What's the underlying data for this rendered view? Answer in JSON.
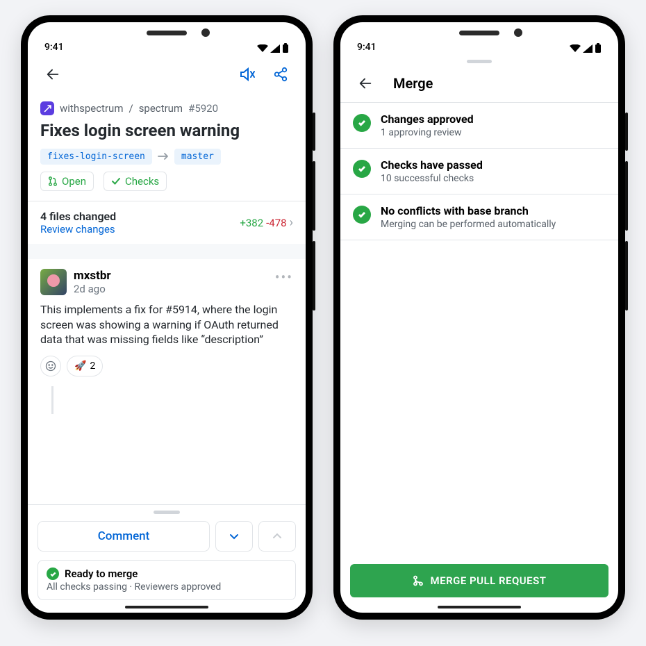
{
  "statusbar": {
    "time": "9:41"
  },
  "left": {
    "breadcrumb": {
      "org": "withspectrum",
      "repo": "spectrum",
      "number": "#5920"
    },
    "pr_title": "Fixes login screen warning",
    "branches": {
      "from": "fixes-login-screen",
      "to": "master"
    },
    "status": {
      "open": "Open",
      "checks": "Checks"
    },
    "files": {
      "label": "4 files changed",
      "link": "Review changes",
      "additions": "+382",
      "deletions": "-478"
    },
    "comment": {
      "author": "mxstbr",
      "time": "2d ago",
      "body": "This implements a fix for #5914, where the login screen was showing a warning if OAuth returned data that was missing fields like “description”",
      "reaction_emoji": "🚀",
      "reaction_count": "2"
    },
    "sheet": {
      "comment_label": "Comment",
      "merge_title": "Ready to merge",
      "merge_subtitle": "All checks passing · Reviewers approved"
    }
  },
  "right": {
    "title": "Merge",
    "items": [
      {
        "title": "Changes approved",
        "subtitle": "1 approving review"
      },
      {
        "title": "Checks have passed",
        "subtitle": "10 successful checks"
      },
      {
        "title": "No conflicts with base branch",
        "subtitle": "Merging can be performed automatically"
      }
    ],
    "cta": "MERGE PULL REQUEST"
  }
}
